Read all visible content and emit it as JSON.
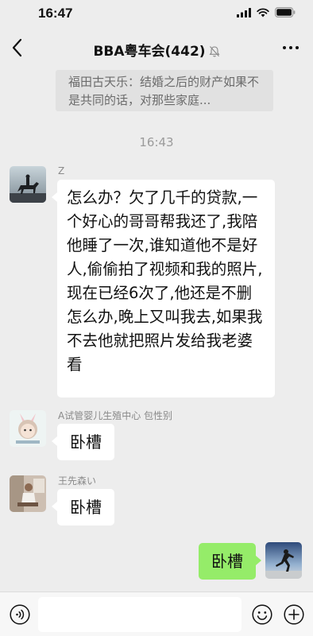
{
  "status_bar": {
    "time": "16:47"
  },
  "header": {
    "title": "BBA粤车会",
    "member_count": "(442)"
  },
  "quoted_message": {
    "text": "福田古天乐：结婚之后的财产如果不是共同的话，对那些家庭..."
  },
  "timestamp": "16:43",
  "messages": [
    {
      "sender": "Z",
      "text": "怎么办？欠了几千的贷款,一个好心的哥哥帮我还了,我陪他睡了一次,谁知道他不是好人,偷偷拍了视频和我的照片,现在已经6次了,他还是不删怎么办,晚上又叫我去,如果我不去他就把照片发给我老婆看",
      "avatar": "horse-rider-avatar"
    },
    {
      "sender": "A试管婴儿生殖中心 包性别",
      "text": "卧槽",
      "avatar": "bunny-girl-avatar"
    },
    {
      "sender": "王先森い",
      "text": "卧槽",
      "avatar": "man-sitting-avatar"
    },
    {
      "sender": "",
      "text": "卧槽",
      "avatar": "runner-avatar",
      "self": true
    }
  ],
  "colors": {
    "background": "#ededed",
    "self_bubble": "#95ec69",
    "other_bubble": "#ffffff"
  },
  "icons": [
    "back-arrow-icon",
    "mute-bell-icon",
    "more-icon",
    "voice-icon",
    "emoji-icon",
    "plus-icon"
  ]
}
